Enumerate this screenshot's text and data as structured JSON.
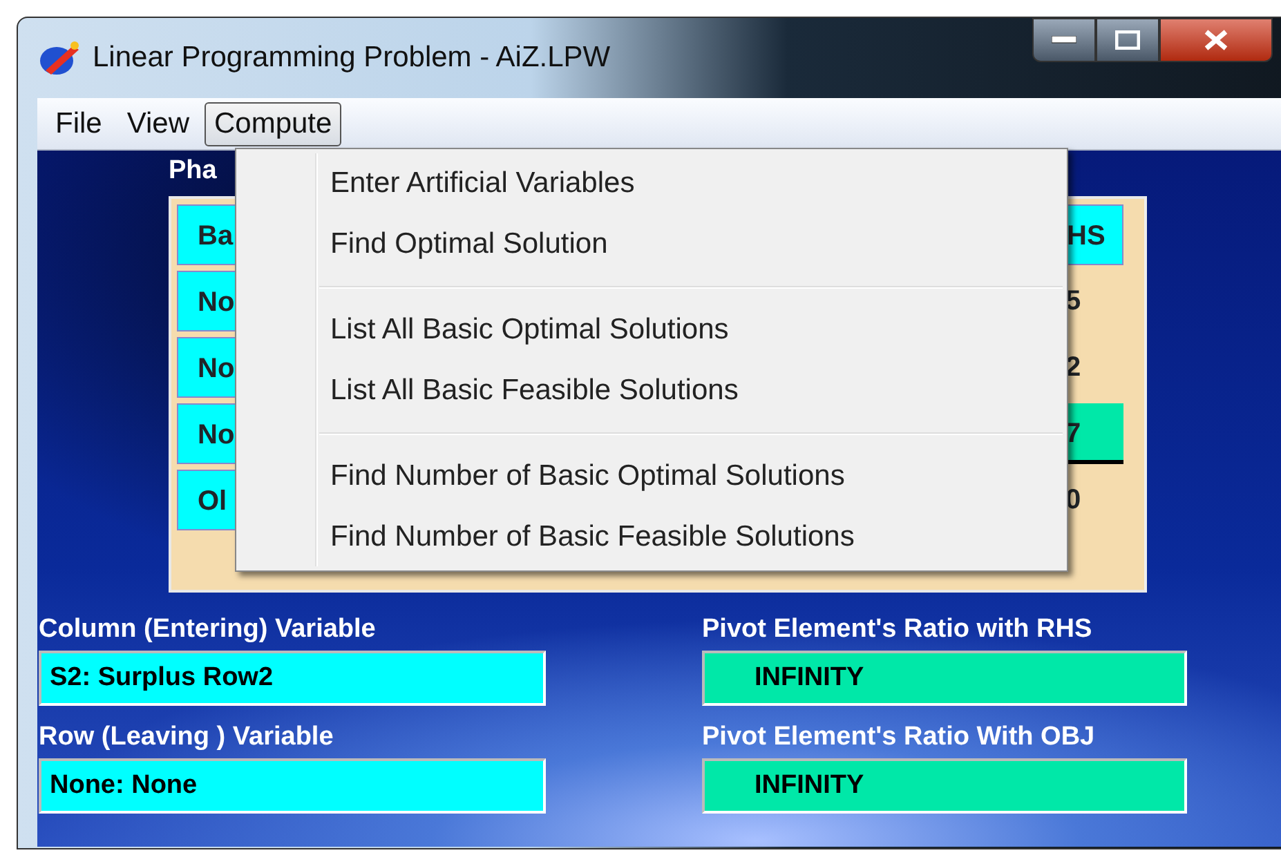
{
  "window": {
    "title": "Linear Programming Problem - AiZ.LPW"
  },
  "menu_bar": [
    {
      "label": "File",
      "selected": false
    },
    {
      "label": "View",
      "selected": false
    },
    {
      "label": "Compute",
      "selected": true
    }
  ],
  "compute_menu": {
    "groups": [
      [
        "Enter Artificial Variables",
        "Find Optimal Solution"
      ],
      [
        "List All Basic Optimal Solutions",
        "List All Basic Feasible Solutions"
      ],
      [
        "Find Number of Basic Optimal Solutions",
        "Find Number of Basic Feasible Solutions"
      ]
    ]
  },
  "tableau": {
    "title": "Pha",
    "column_1": [
      {
        "text": "Ba",
        "kind": "header"
      },
      {
        "text": "No",
        "kind": "header"
      },
      {
        "text": "No",
        "kind": "header"
      },
      {
        "text": "No",
        "kind": "header"
      },
      {
        "text": "Ol",
        "kind": "header"
      }
    ],
    "rhs_column": [
      {
        "text": "HS",
        "kind": "header"
      },
      {
        "text": "5",
        "kind": "value"
      },
      {
        "text": "2",
        "kind": "value"
      },
      {
        "text": "7",
        "kind": "pivot"
      },
      {
        "text": "0",
        "kind": "value"
      }
    ]
  },
  "fields": [
    {
      "label": "Column (Entering) Variable",
      "value": "S2: Surplus Row2",
      "color": "#00ffff"
    },
    {
      "label": "Pivot Element's Ratio with RHS",
      "value": "INFINITY",
      "color": "#00e8a8"
    },
    {
      "label": "Row (Leaving ) Variable",
      "value": "None: None",
      "color": "#00ffff"
    },
    {
      "label": "Pivot Element's Ratio With OBJ",
      "value": "INFINITY",
      "color": "#00e8a8"
    }
  ]
}
